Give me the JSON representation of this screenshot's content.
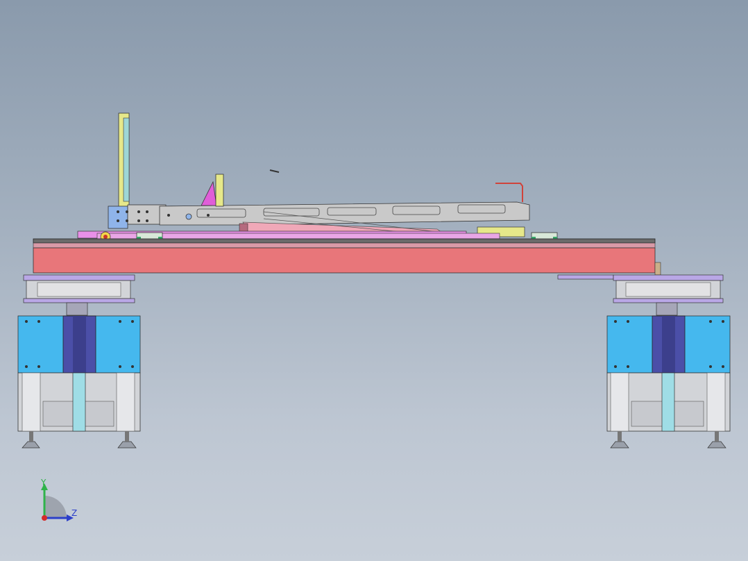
{
  "view": {
    "background_top": "#8a9aac",
    "background_bottom": "#c7cfd9"
  },
  "triad": {
    "y_label": "Y",
    "z_label": "Z",
    "y_color": "#2fb34a",
    "z_color": "#2c3fc9",
    "x_color": "#d42b2b"
  },
  "parts": {
    "base_beam_color": "#e8767a",
    "carriage_plate_color": "#e890e8",
    "arm_color": "#c9c9c9",
    "block_color": "#45b8ee",
    "column_color": "#4b4fa8",
    "frame_color": "#d2d4d8",
    "leg_rod_color": "#9fdde6",
    "pad_color": "#b9a7e6",
    "bracket_color": "#e6e88a",
    "gusset_color": "#e05ed8",
    "guide_block_color": "#3aa86a",
    "wire_color": "#d0433a"
  }
}
